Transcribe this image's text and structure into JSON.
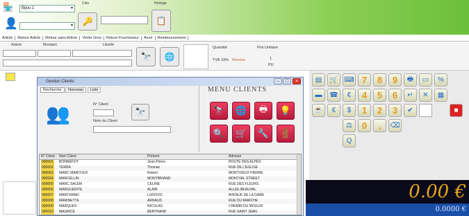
{
  "topbar": {
    "selector_value": "Bijou 1",
    "toolbar_label_1": "Clés",
    "toolbar_label_2": "Horloge"
  },
  "tabs": [
    "Article",
    "Retour Article",
    "Retour sans Article",
    "Vente Gros",
    "Retour Fournisseur",
    "Avoir",
    "Remboursement"
  ],
  "fields": {
    "article_label": "Article",
    "montant_label": "Montant",
    "libelle_label": "Libellé",
    "quantite_label": "Quantité",
    "prix_label": "Prix Unitaire",
    "tva_label": "TVA",
    "tva_value": "19%",
    "remise_label": "Remise",
    "qty_value": "1",
    "unit_value": "PU"
  },
  "keypad": {
    "numbers": [
      "7",
      "8",
      "9",
      "4",
      "5",
      "6",
      "1",
      "2",
      "3",
      "0"
    ],
    "dot": ",",
    "icons": [
      "scanner",
      "cart",
      "keyboard",
      "printer",
      "drawer",
      "percent",
      "euro",
      "cash",
      "card",
      "clear",
      "enter",
      "calc"
    ]
  },
  "totals": {
    "total": "0.00 €",
    "subtotal": "0.0000 €"
  },
  "dialog": {
    "title": "Gestion Clients",
    "tabs": [
      "Recherche",
      "Nouveau",
      "Liste"
    ],
    "code_label": "N° Client",
    "name_label": "Nom du Client",
    "menu_title": "MENU CLIENTS",
    "columns": [
      "N° Client",
      "Nom Client",
      "Prénom",
      "Adresse"
    ],
    "rows": [
      [
        "000001",
        "BONNEFOY",
        "Jean-Pierre",
        "ROUTE DES ALPES"
      ],
      [
        "000002",
        "TERRA",
        "Thomas",
        "RUE DE L'EGLISE"
      ],
      [
        "000003",
        "MARC MARCOUX",
        "Robert",
        "MONTVIEUX PIERRE"
      ],
      [
        "000004",
        "MARCELLIN",
        "MONTBRIAND",
        "MONTVAL STREET"
      ],
      [
        "000005",
        "MARC SALEM",
        "CELINE",
        "RUE DES FLEURS"
      ],
      [
        "000006",
        "MARGUERITE",
        "ALAIN",
        "ALLEE BEAUVAL"
      ],
      [
        "000007",
        "MARCHAND",
        "LUDOVIC",
        "AVENUE DE LA GARE"
      ],
      [
        "000008",
        "MARINETTE",
        "ARNAUD",
        "RUE DU MARCHE"
      ],
      [
        "000009",
        "MARQUES",
        "NICOLAS",
        "CHEMIN DU MOULIN"
      ],
      [
        "000010",
        "MAURICE",
        "BERTRAND",
        "RUE SAINT JEAN"
      ]
    ]
  }
}
